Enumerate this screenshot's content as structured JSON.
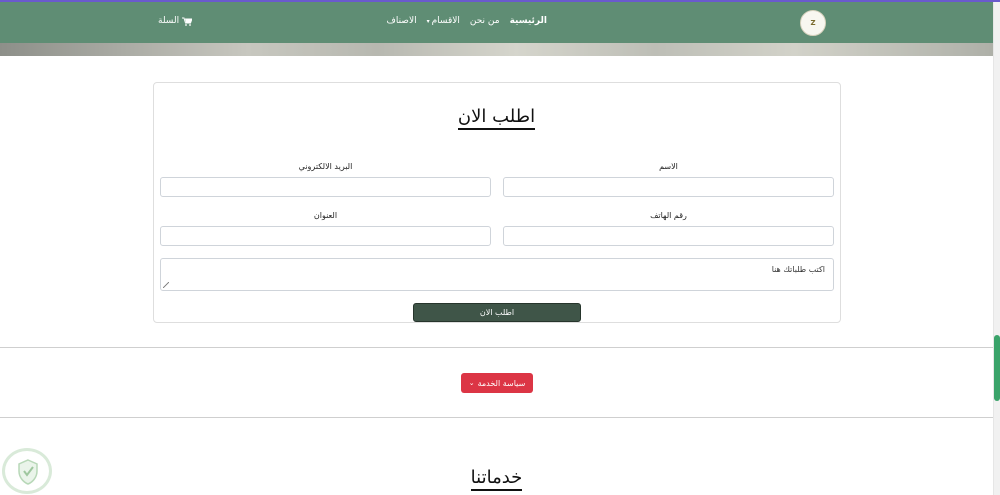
{
  "nav": {
    "links": [
      {
        "label": "الرئيسية",
        "active": true
      },
      {
        "label": "من نحن"
      },
      {
        "label": "الاقسام",
        "caret": "▾"
      },
      {
        "label": "الاصناف"
      }
    ],
    "cart_label": "السلة",
    "logo_text": "Z"
  },
  "form": {
    "title": "اطلب الان",
    "name_label": "الاسم",
    "email_label": "البريد الالكتروني",
    "phone_label": "رقم الهاتف",
    "address_label": "العنوان",
    "message_placeholder": "اكتب طلباتك هنا",
    "submit_label": "اطلب الان"
  },
  "policy": {
    "button_label": "سياسة الخدمة",
    "chevron": "⌄"
  },
  "services": {
    "title": "خدماتنا"
  },
  "colors": {
    "navbar": "#5f8d74",
    "submit": "#3f5548",
    "policy": "#dc3545",
    "scroll_thumb": "#3aa36a"
  }
}
